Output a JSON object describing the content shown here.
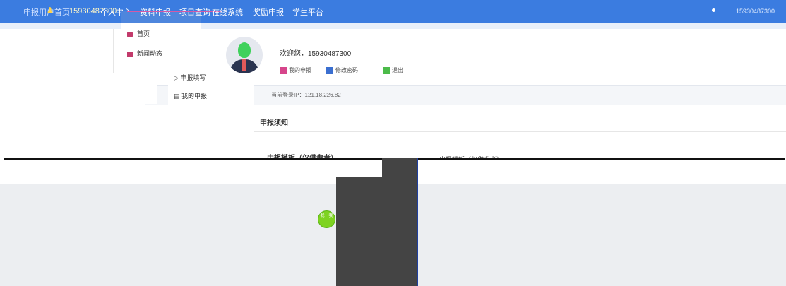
{
  "topbar": {
    "left_link": "申报用户首页",
    "phone": "15930487300",
    "nav_items": [
      "个人中心",
      "资料申报",
      "项目查询",
      "在线系统",
      "奖励申报",
      "学生平台"
    ]
  },
  "dropdown": {
    "items": [
      "首页",
      "新闻动态"
    ]
  },
  "profile": {
    "welcome": "欢迎您，15930487300",
    "quick_links": [
      "我的申报",
      "修改密码",
      "退出"
    ]
  },
  "sidebar2": {
    "items": [
      "申报填写",
      "我的申报"
    ]
  },
  "ip": {
    "text": "当前登录IP：121.18.226.82"
  },
  "notice": {
    "title": "申报须知",
    "template_title": "申报模板（仅供参考）",
    "template_right": "申报模板（仅供参考）"
  },
  "bubble": {
    "text": "我一我"
  },
  "colors": {
    "topbar": "#3b7ce0",
    "accent_green": "#7ed321",
    "overlay_dark": "#444444"
  }
}
